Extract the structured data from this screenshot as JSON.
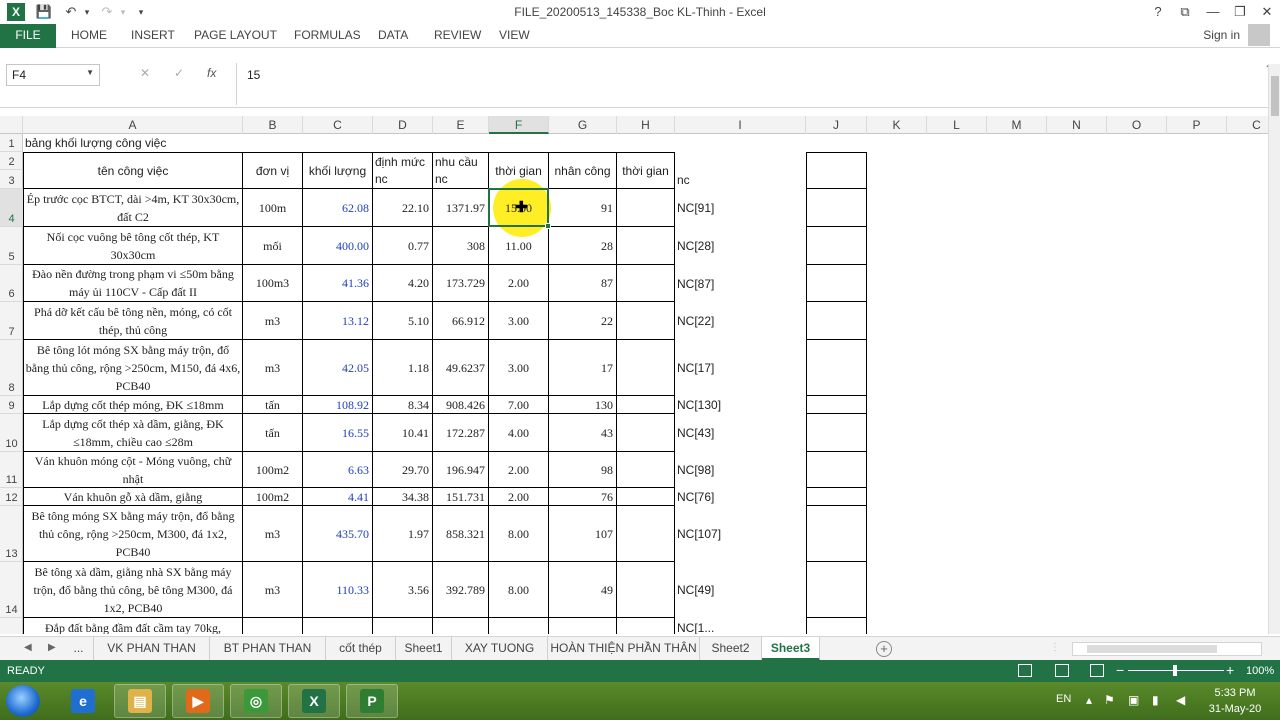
{
  "window": {
    "title": "FILE_20200513_145338_Boc KL-Thinh - Excel",
    "app_badge": "X",
    "controls": {
      "help": "?",
      "restore_ribbon": "⧉",
      "minimize": "—",
      "maximize": "❐",
      "close": "✕"
    }
  },
  "qat": {
    "save": "💾",
    "undo": "↶",
    "undo_drop": "▾",
    "redo": "↷",
    "redo_drop": "▾",
    "customize": "▾"
  },
  "ribbon": {
    "file": "FILE",
    "tabs": [
      "HOME",
      "INSERT",
      "PAGE LAYOUT",
      "FORMULAS",
      "DATA",
      "REVIEW",
      "VIEW"
    ],
    "sign_in": "Sign in"
  },
  "formula_bar": {
    "name_box": "F4",
    "name_box_arrow": "▼",
    "cancel": "✕",
    "enter": "✓",
    "fx": "fx",
    "value": "15",
    "collapse": "⌃"
  },
  "columns": [
    "A",
    "B",
    "C",
    "D",
    "E",
    "F",
    "G",
    "H",
    "I",
    "J",
    "K",
    "L",
    "M",
    "N",
    "O",
    "P",
    "C"
  ],
  "active_column": "F",
  "active_row": "4",
  "rows": [
    "1",
    "2",
    "3",
    "4",
    "5",
    "6",
    "7",
    "8",
    "9",
    "10",
    "11",
    "12",
    "13",
    "14",
    ""
  ],
  "sheet": {
    "title": "bảng khối lượng công việc",
    "headers": {
      "ten_cong_viec": "tên công việc",
      "don_vi": "đơn vị",
      "khoi_luong": "khối lượng",
      "dinh_muc": "định mức",
      "dinh_muc_sub": "nc",
      "nhu_cau": "nhu cầu",
      "nhu_cau_sub": "nc",
      "thoi_gian": "thời gian",
      "nhan_cong": "nhân công",
      "thoi_gian_h": "thời gian",
      "nc": "nc"
    },
    "data": [
      {
        "name": "Ép trước cọc BTCT, dài >4m, KT 30x30cm, đất C2",
        "unit": "100m",
        "qty": "62.08",
        "norm": "22.10",
        "need": "1371.97",
        "time": "15.00",
        "labor": "91",
        "ref": "NC[91]"
      },
      {
        "name": "Nối cọc vuông bê tông cốt thép, KT 30x30cm",
        "unit": "mối",
        "qty": "400.00",
        "norm": "0.77",
        "need": "308",
        "time": "11.00",
        "labor": "28",
        "ref": "NC[28]"
      },
      {
        "name": "Đào nền đường trong phạm vi ≤50m bằng máy ủi 110CV - Cấp đất II",
        "unit": "100m3",
        "qty": "41.36",
        "norm": "4.20",
        "need": "173.729",
        "time": "2.00",
        "labor": "87",
        "ref": "NC[87]"
      },
      {
        "name": "Phá dỡ kết cấu bê tông nền, móng, có cốt thép, thủ công",
        "unit": "m3",
        "qty": "13.12",
        "norm": "5.10",
        "need": "66.912",
        "time": "3.00",
        "labor": "22",
        "ref": "NC[22]"
      },
      {
        "name": "Bê tông lót móng SX bằng máy trộn, đổ bằng thủ công, rộng >250cm, M150, đá 4x6, PCB40",
        "unit": "m3",
        "qty": "42.05",
        "norm": "1.18",
        "need": "49.6237",
        "time": "3.00",
        "labor": "17",
        "ref": "NC[17]"
      },
      {
        "name": "Lắp dựng cốt thép móng, ĐK ≤18mm",
        "unit": "tấn",
        "qty": "108.92",
        "norm": "8.34",
        "need": "908.426",
        "time": "7.00",
        "labor": "130",
        "ref": "NC[130]"
      },
      {
        "name": "Lắp dựng cốt thép xà dầm, giằng, ĐK ≤18mm, chiều cao ≤28m",
        "unit": "tấn",
        "qty": "16.55",
        "norm": "10.41",
        "need": "172.287",
        "time": "4.00",
        "labor": "43",
        "ref": "NC[43]"
      },
      {
        "name": "Ván khuôn móng cột - Móng vuông, chữ nhật",
        "unit": "100m2",
        "qty": "6.63",
        "norm": "29.70",
        "need": "196.947",
        "time": "2.00",
        "labor": "98",
        "ref": "NC[98]"
      },
      {
        "name": "Ván khuôn gỗ xà dầm, giằng",
        "unit": "100m2",
        "qty": "4.41",
        "norm": "34.38",
        "need": "151.731",
        "time": "2.00",
        "labor": "76",
        "ref": "NC[76]"
      },
      {
        "name": "Bê tông móng SX bằng máy trộn, đổ bằng thủ công, rộng >250cm, M300, đá 1x2, PCB40",
        "unit": "m3",
        "qty": "435.70",
        "norm": "1.97",
        "need": "858.321",
        "time": "8.00",
        "labor": "107",
        "ref": "NC[107]"
      },
      {
        "name": "Bê tông xà dầm, giằng nhà SX bằng máy trộn, đổ bằng thủ công, bê tông M300, đá 1x2, PCB40",
        "unit": "m3",
        "qty": "110.33",
        "norm": "3.56",
        "need": "392.789",
        "time": "8.00",
        "labor": "49",
        "ref": "NC[49]"
      },
      {
        "name": "Đắp đất bằng đầm đất cầm tay 70kg,",
        "unit": "",
        "qty": "",
        "norm": "",
        "need": "",
        "time": "",
        "labor": "",
        "ref": "NC[1..."
      }
    ]
  },
  "sheet_tabs": {
    "nav_prev": "◀",
    "nav_next": "▶",
    "more": "...",
    "tabs": [
      "VK PHAN THAN",
      "BT PHAN THAN",
      "cốt thép",
      "Sheet1",
      "XAY TUONG",
      "HOÀN THIỆN PHẦN THÂN",
      "Sheet2",
      "Sheet3"
    ],
    "active": "Sheet3",
    "add": "+"
  },
  "status": {
    "text": "READY",
    "zoom_minus": "−",
    "zoom_plus": "+",
    "zoom": "100%"
  },
  "taskbar": {
    "apps": [
      {
        "name": "Internet Explorer",
        "glyph": "e",
        "color": "#1f6fd0"
      },
      {
        "name": "Windows Explorer",
        "glyph": "▤",
        "color": "#e0b24a"
      },
      {
        "name": "Media Player",
        "glyph": "▶",
        "color": "#e06a1a"
      },
      {
        "name": "Chrome",
        "glyph": "◎",
        "color": "#3a9a3a"
      },
      {
        "name": "Excel",
        "glyph": "X",
        "color": "#217346"
      },
      {
        "name": "Project",
        "glyph": "P",
        "color": "#2e7d32"
      }
    ],
    "lang": "EN",
    "time": "5:33 PM",
    "date": "31-May-20"
  }
}
